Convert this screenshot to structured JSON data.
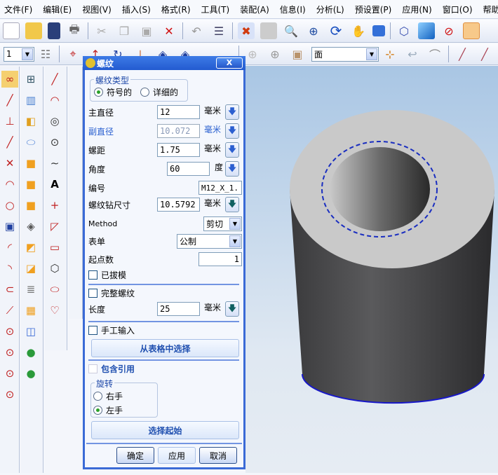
{
  "menu": [
    "文件(F)",
    "编辑(E)",
    "视图(V)",
    "插入(S)",
    "格式(R)",
    "工具(T)",
    "装配(A)",
    "信息(I)",
    "分析(L)",
    "预设置(P)",
    "应用(N)",
    "窗口(O)",
    "帮助(H)"
  ],
  "toolbar2": {
    "layer_value": "1",
    "filter_value": "面"
  },
  "dialog": {
    "title": "螺纹",
    "close": "X",
    "thread_type": {
      "label": "螺纹类型",
      "options": [
        "符号的",
        "详细的"
      ],
      "selected": "符号的"
    },
    "major_dia": {
      "label": "主直径",
      "value": "12",
      "unit": "毫米"
    },
    "minor_dia": {
      "label": "副直径",
      "value": "10.072",
      "unit": "毫米"
    },
    "pitch": {
      "label": "螺距",
      "value": "1.75",
      "unit": "毫米"
    },
    "angle": {
      "label": "角度",
      "value": "60",
      "unit": "度"
    },
    "callout": {
      "label": "编号",
      "value": "M12_X_1."
    },
    "tap_drill": {
      "label": "螺纹钻尺寸",
      "value": "10.5792",
      "unit": "毫米"
    },
    "method": {
      "label": "Method",
      "value": "剪切"
    },
    "form": {
      "label": "表单",
      "value": "公制"
    },
    "starts": {
      "label": "起点数",
      "value": "1"
    },
    "tapered": {
      "label": "已拔模",
      "checked": false
    },
    "full_thread": {
      "label": "完整螺纹",
      "checked": false
    },
    "length": {
      "label": "长度",
      "value": "25",
      "unit": "毫米"
    },
    "manual": {
      "label": "手工输入",
      "checked": false
    },
    "choose_table": "从表格中选择",
    "include_instances": {
      "label": "包含引用",
      "checked": false
    },
    "rotation": {
      "label": "旋转",
      "options": [
        "右手",
        "左手"
      ],
      "selected": "左手"
    },
    "select_start": "选择起始",
    "ok": "确定",
    "apply": "应用",
    "cancel": "取消"
  },
  "colors": {
    "accent": "#3a6ad6",
    "thread_dash": "#1a2ec0"
  }
}
